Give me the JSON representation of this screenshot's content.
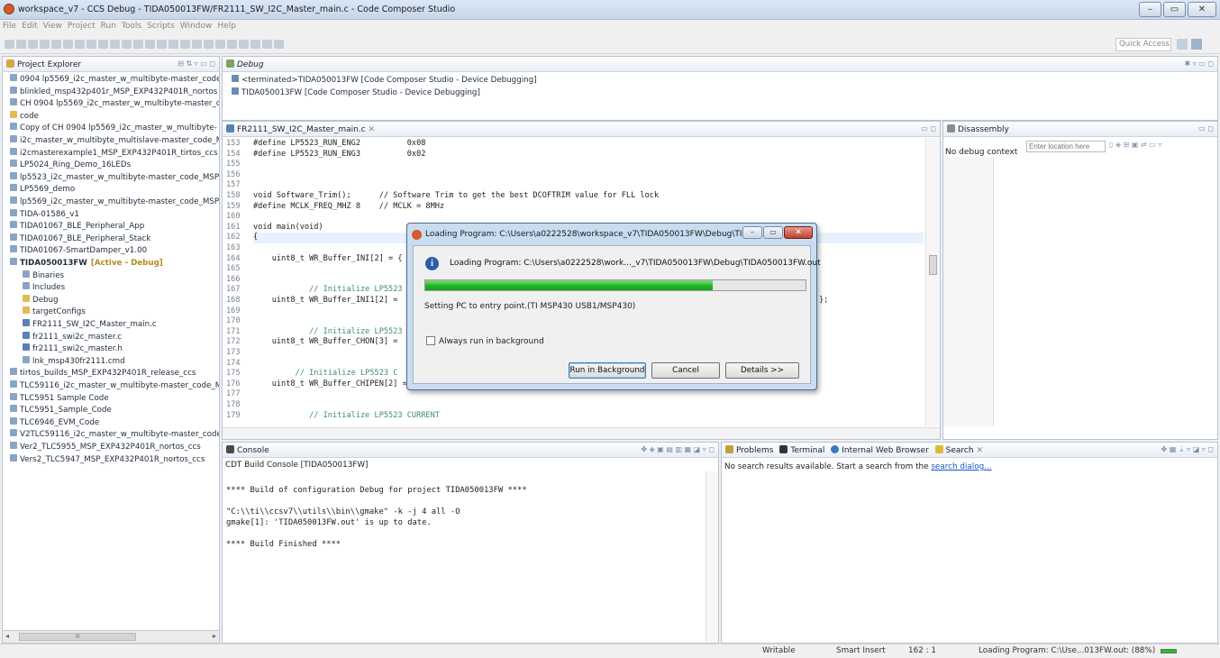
{
  "window": {
    "title": "workspace_v7 - CCS Debug - TIDA050013FW/FR2111_SW_I2C_Master_main.c - Code Composer Studio",
    "minimize": "–",
    "maximize": "▭",
    "close": "✕"
  },
  "menu": [
    "File",
    "Edit",
    "View",
    "Project",
    "Run",
    "Tools",
    "Scripts",
    "Window",
    "Help"
  ],
  "quick_access": "Quick Access",
  "project_explorer": {
    "title": "Project Explorer",
    "items": [
      {
        "label": "0904 lp5569_i2c_master_w_multibyte-master_code"
      },
      {
        "label": "blinkled_msp432p401r_MSP_EXP432P401R_nortos"
      },
      {
        "label": "CH 0904 lp5569_i2c_master_w_multibyte-master_c"
      },
      {
        "label": "code"
      },
      {
        "label": "Copy of CH 0904 lp5569_i2c_master_w_multibyte-"
      },
      {
        "label": "i2c_master_w_multibyte_multislave-master_code_M"
      },
      {
        "label": "i2cmasterexample1_MSP_EXP432P401R_tirtos_ccs"
      },
      {
        "label": "LP5024_Ring_Demo_16LEDs"
      },
      {
        "label": "lp5523_i2c_master_w_multibyte-master_code_MSP"
      },
      {
        "label": "LP5569_demo"
      },
      {
        "label": "lp5569_i2c_master_w_multibyte-master_code_MSP"
      },
      {
        "label": "TIDA-01586_v1"
      },
      {
        "label": "TIDA01067_BLE_Peripheral_App"
      },
      {
        "label": "TIDA01067_BLE_Peripheral_Stack"
      },
      {
        "label": "TIDA01067-SmartDamper_v1.00"
      },
      {
        "label": "TIDA050013FW",
        "suffix": "[Active - Debug]"
      },
      {
        "label": "Binaries"
      },
      {
        "label": "Includes"
      },
      {
        "label": "Debug"
      },
      {
        "label": "targetConfigs"
      },
      {
        "label": "FR2111_SW_I2C_Master_main.c"
      },
      {
        "label": "fr2111_swi2c_master.c"
      },
      {
        "label": "fr2111_swi2c_master.h"
      },
      {
        "label": "lnk_msp430fr2111.cmd"
      },
      {
        "label": "tirtos_builds_MSP_EXP432P401R_release_ccs"
      },
      {
        "label": "TLC59116_i2c_master_w_multibyte-master_code_M"
      },
      {
        "label": "TLC5951 Sample Code"
      },
      {
        "label": "TLC5951_Sample_Code"
      },
      {
        "label": "TLC6946_EVM_Code"
      },
      {
        "label": "V2TLC59116_i2c_master_w_multibyte-master_code"
      },
      {
        "label": "Ver2_TLC5955_MSP_EXP432P401R_nortos_ccs"
      },
      {
        "label": "Vers2_TLC5947_MSP_EXP432P401R_nortos_ccs"
      }
    ],
    "scroll_mid": "III"
  },
  "debug": {
    "title": "Debug",
    "items": [
      "<terminated>TIDA050013FW [Code Composer Studio - Device Debugging]",
      "TIDA050013FW [Code Composer Studio - Device Debugging]"
    ]
  },
  "editor": {
    "tab": "FR2111_SW_I2C_Master_main.c",
    "lines": [
      {
        "n": "153",
        "t": "#define LP5523_RUN_ENG2          0x08"
      },
      {
        "n": "154",
        "t": "#define LP5523_RUN_ENG3          0x02"
      },
      {
        "n": "155",
        "t": ""
      },
      {
        "n": "156",
        "t": ""
      },
      {
        "n": "157",
        "t": ""
      },
      {
        "n": "158",
        "t": "void Software_Trim();      // Software Trim to get the best DCOFTRIM value for FLL lock"
      },
      {
        "n": "159",
        "t": "#define MCLK_FREQ_MHZ 8    // MCLK = 8MHz"
      },
      {
        "n": "160",
        "t": ""
      },
      {
        "n": "161",
        "t": "void main(void)"
      },
      {
        "n": "162",
        "t": "{"
      },
      {
        "n": "163",
        "t": ""
      },
      {
        "n": "164",
        "t": "    uint8_t WR_Buffer_INI[2] = {"
      },
      {
        "n": "165",
        "t": ""
      },
      {
        "n": "166",
        "t": ""
      },
      {
        "n": "167",
        "t": "            // Initialize LP5523"
      },
      {
        "n": "168",
        "t": "    uint8_t WR_Buffer_INI1[2] ="
      },
      {
        "n": "169",
        "t": ""
      },
      {
        "n": "170",
        "t": ""
      },
      {
        "n": "171",
        "t": "            // Initialize LP5523"
      },
      {
        "n": "172",
        "t": "    uint8_t WR_Buffer_CHON[3] ="
      },
      {
        "n": "173",
        "t": ""
      },
      {
        "n": "174",
        "t": ""
      },
      {
        "n": "175",
        "t": "         // Initialize LP5523 C"
      },
      {
        "n": "176",
        "t": "    uint8_t WR_Buffer_CHIPEN[2] = {LP5523_REG_ENABLE,LP5523_ENABLE};"
      },
      {
        "n": "177",
        "t": ""
      },
      {
        "n": "178",
        "t": ""
      },
      {
        "n": "179",
        "t": "            // Initialize LP5523 CURRENT"
      }
    ],
    "trail_168": "};"
  },
  "disassembly": {
    "title": "Disassembly",
    "location_placeholder": "Enter location here",
    "context": "No debug context"
  },
  "console": {
    "title": "Console",
    "subtitle": "CDT Build Console [TIDA050013FW]",
    "lines": [
      "**** Build of configuration Debug for project TIDA050013FW ****",
      "",
      "\"C:\\\\ti\\\\ccsv7\\\\utils\\\\bin\\\\gmake\" -k -j 4 all -O",
      "gmake[1]: 'TIDA050013FW.out' is up to date.",
      "",
      "**** Build Finished ****"
    ]
  },
  "bottom_tabs": {
    "problems": "Problems",
    "terminal": "Terminal",
    "browser": "Internal Web Browser",
    "search": "Search",
    "search_msg": "No search results available. Start a search from the ",
    "search_link": "search dialog..."
  },
  "dialog": {
    "title": "Loading Program: C:\\Users\\a0222528\\workspace_v7\\TIDA050013FW\\Debug\\TID...",
    "message": "Loading Program: C:\\Users\\a0222528\\work..._v7\\TIDA050013FW\\Debug\\TIDA050013FW.out",
    "progress": 0.88,
    "status": "Setting PC to entry point.(TI MSP430 USB1/MSP430)",
    "checkbox": "Always run in background",
    "btn_background": "Run in Background",
    "btn_cancel": "Cancel",
    "btn_details": "Details >>"
  },
  "statusbar": {
    "writable": "Writable",
    "insert": "Smart Insert",
    "position": "162 : 1",
    "loading": "Loading Program: C:\\Use...013FW.out: (88%)"
  },
  "colors": {
    "progress": "#22c12a",
    "accent": "#2a5fa8"
  }
}
